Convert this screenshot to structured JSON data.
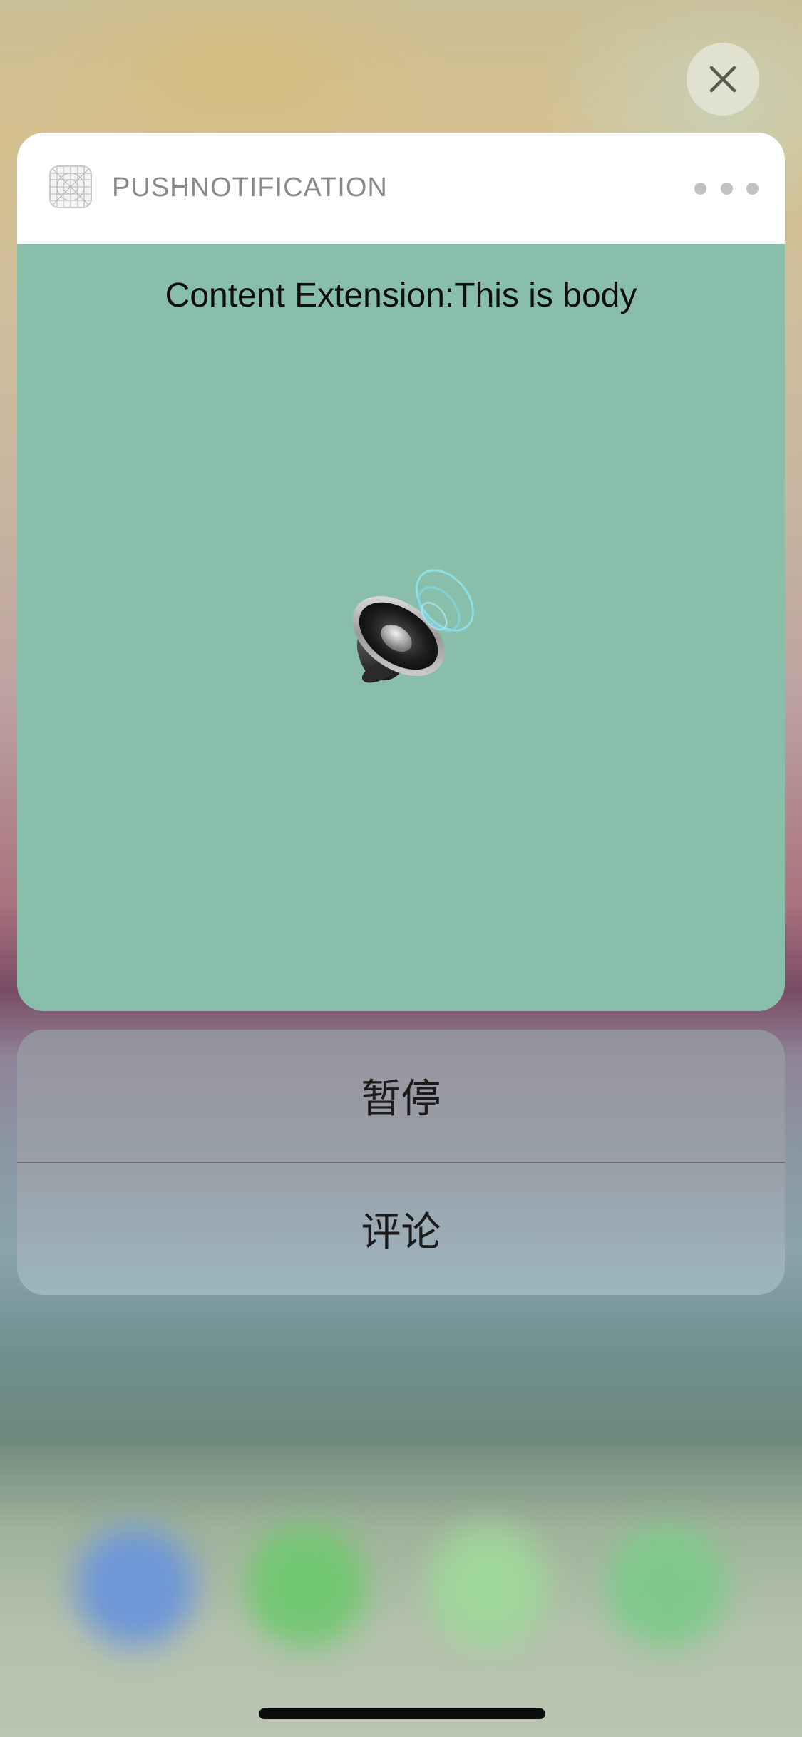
{
  "notification": {
    "app_name": "PUSHNOTIFICATION",
    "body": "Content Extension:This is body",
    "app_icon": "app-placeholder-icon",
    "media_icon": "speaker-icon",
    "background_color": "#89bfaa"
  },
  "actions": [
    {
      "label": "暂停"
    },
    {
      "label": "评论"
    }
  ],
  "controls": {
    "close_icon": "close-icon",
    "more_icon": "more-dots-icon"
  }
}
